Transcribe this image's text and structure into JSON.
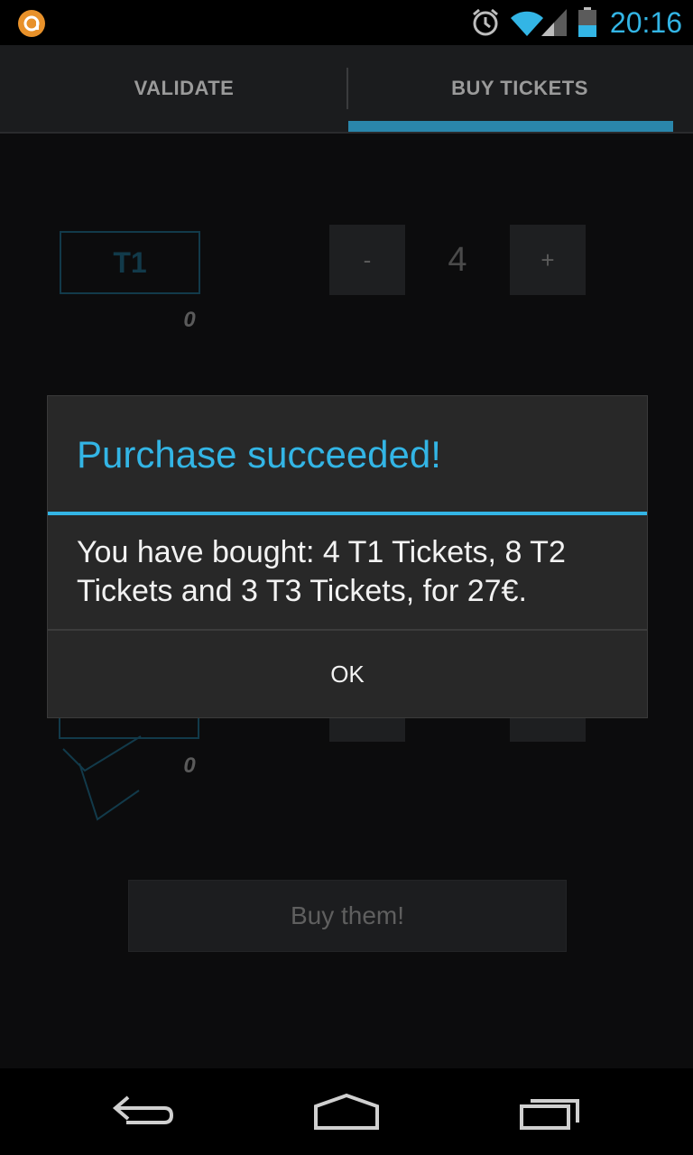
{
  "status_bar": {
    "time": "20:16",
    "icons": [
      "app-notification-icon",
      "alarm-icon",
      "wifi-icon",
      "signal-icon",
      "battery-icon"
    ],
    "accent": "#33b5e5"
  },
  "tabs": [
    {
      "label": "VALIDATE",
      "selected": false
    },
    {
      "label": "BUY TICKETS",
      "selected": true
    }
  ],
  "tickets": [
    {
      "type": "T1",
      "owned": "0",
      "quantity": "4",
      "minus": "-",
      "plus": "+"
    },
    {
      "type": "",
      "owned": "0",
      "quantity": "",
      "minus": "",
      "plus": ""
    }
  ],
  "buy_button": {
    "label": "Buy them!"
  },
  "dialog": {
    "title": "Purchase succeeded!",
    "message": "You have bought: 4 T1 Tickets, 8 T2 Tickets and 3 T3 Tickets, for 27€.",
    "ok_label": "OK"
  },
  "nav_bar": {
    "icons": [
      "back-icon",
      "home-icon",
      "recent-apps-icon"
    ]
  }
}
